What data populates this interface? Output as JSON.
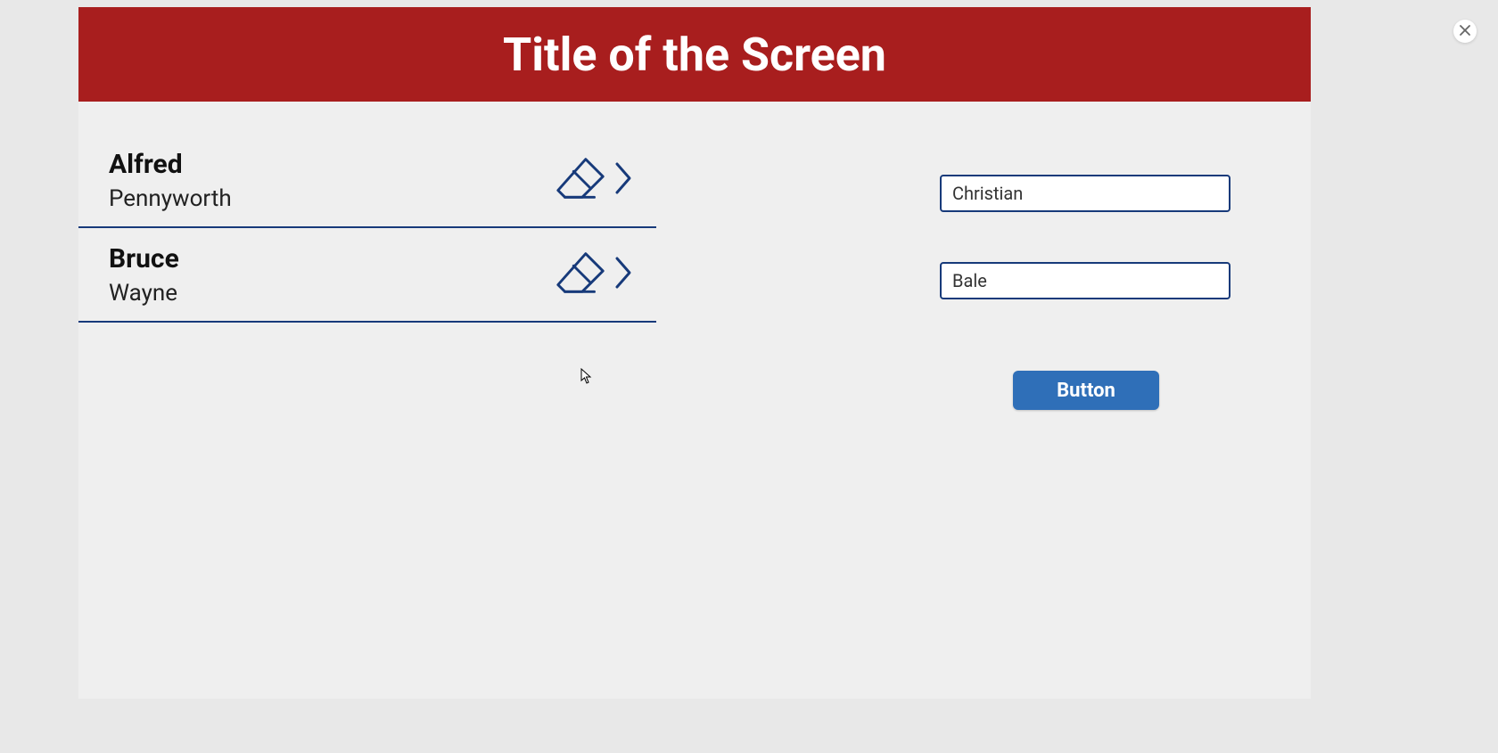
{
  "header": {
    "title": "Title of the Screen"
  },
  "list": [
    {
      "first": "Alfred",
      "second": "Pennyworth"
    },
    {
      "first": "Bruce",
      "second": "Wayne"
    }
  ],
  "form": {
    "input1_value": "Christian",
    "input2_value": "Bale",
    "button_label": "Button"
  },
  "colors": {
    "header_bg": "#a81e1e",
    "accent": "#173a7a",
    "button_bg": "#2f6fb8"
  }
}
